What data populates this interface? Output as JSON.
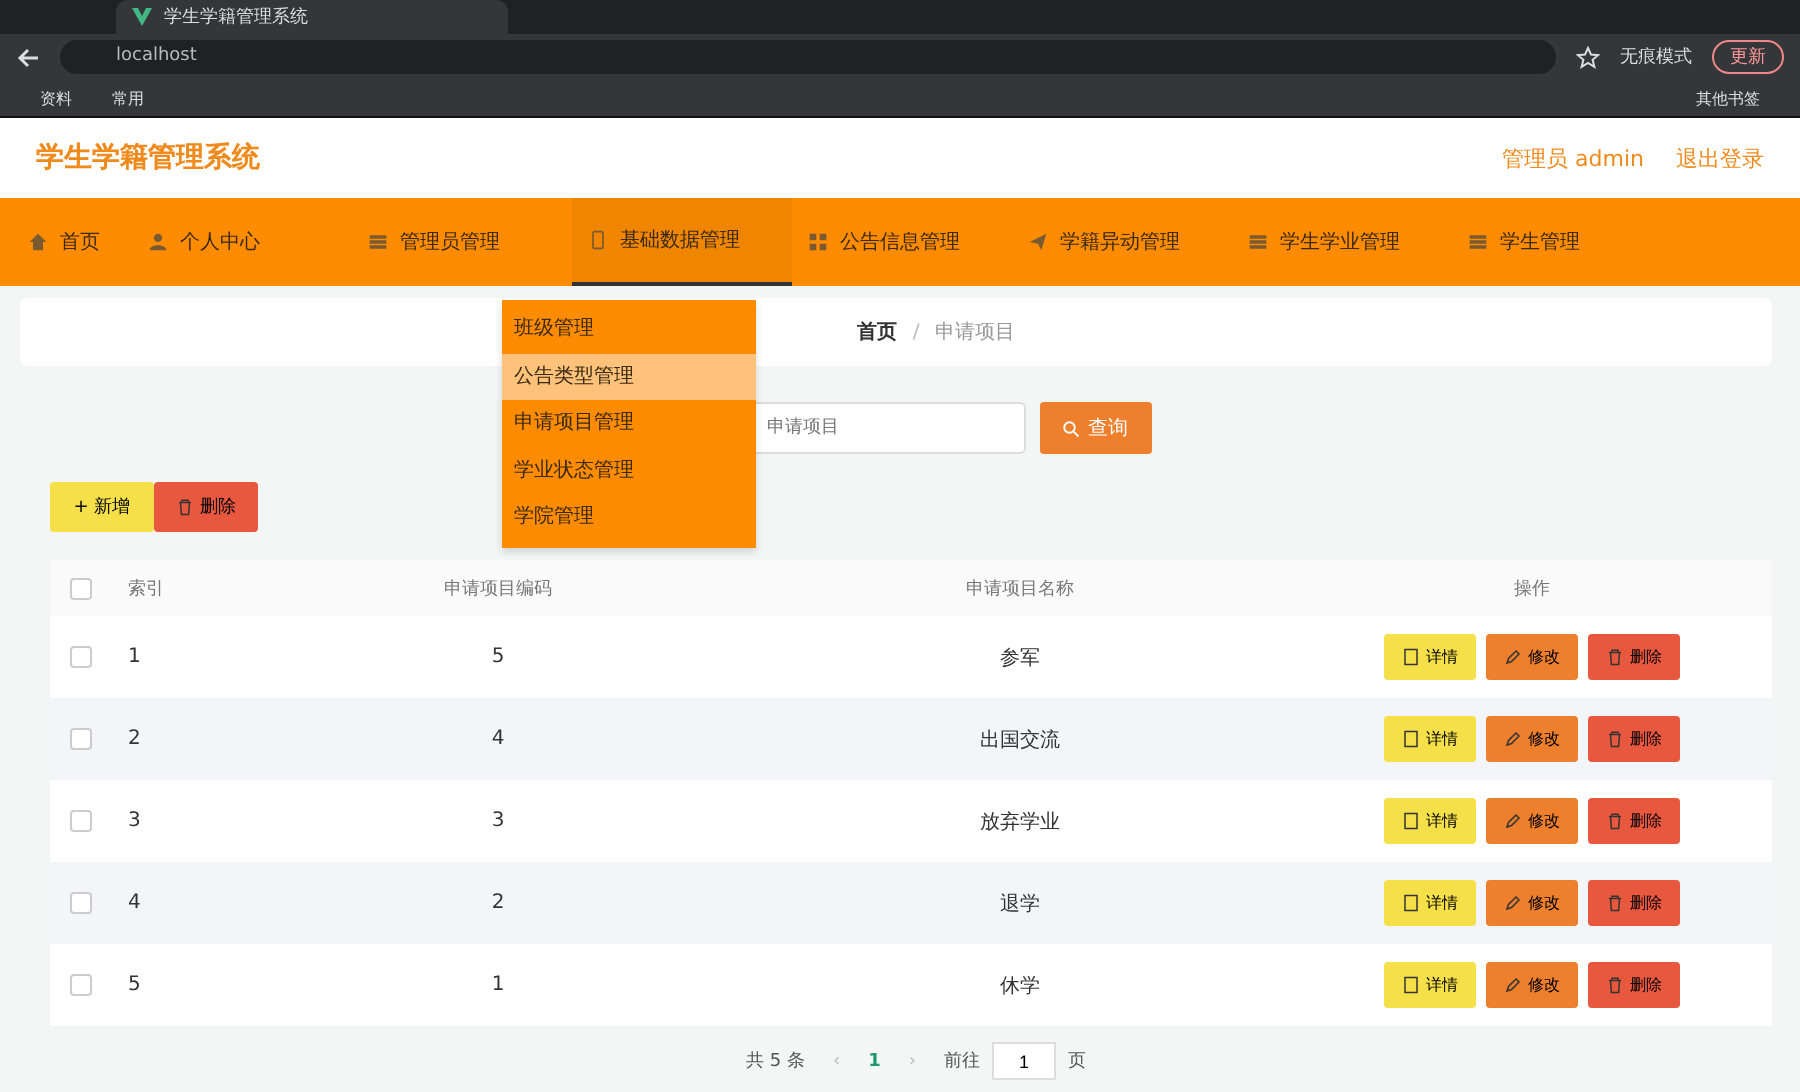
{
  "browser": {
    "tab_title": "学生学籍管理系统",
    "address": "localhost",
    "profile": "无痕模式",
    "update_button": "更新",
    "bookmarks": [
      "资料",
      "常用"
    ],
    "other_bookmarks": "其他书签"
  },
  "header": {
    "title": "学生学籍管理系统",
    "user": "管理员 admin",
    "logout": "退出登录"
  },
  "nav": [
    {
      "label": "首页",
      "selected": false
    },
    {
      "label": "个人中心",
      "selected": false
    },
    {
      "label": "管理员管理",
      "selected": false
    },
    {
      "label": "基础数据管理",
      "selected": true
    },
    {
      "label": "公告信息管理",
      "selected": false
    },
    {
      "label": "学籍异动管理",
      "selected": false
    },
    {
      "label": "学生学业管理",
      "selected": false
    },
    {
      "label": "学生管理",
      "selected": false
    }
  ],
  "dropdown": [
    {
      "label": "班级管理",
      "selected": false
    },
    {
      "label": "公告类型管理",
      "selected": true
    },
    {
      "label": "申请项目管理",
      "selected": false
    },
    {
      "label": "学业状态管理",
      "selected": false
    },
    {
      "label": "学院管理",
      "selected": false
    }
  ],
  "breadcrumb": {
    "items": [
      "首页",
      "申请项目"
    ],
    "separator": "/"
  },
  "search": {
    "placeholder": "申请项目",
    "button": "查询"
  },
  "actions": {
    "add": "+ 新增",
    "delete": "删除"
  },
  "table": {
    "select_all_checked": false,
    "columns": [
      "索引",
      "申请项目编码",
      "申请项目名称",
      "操作"
    ],
    "rows": [
      {
        "index": "1",
        "code": "5",
        "name": "参军",
        "checked": false,
        "buttons": [
          "详情",
          "修改",
          "删除"
        ]
      },
      {
        "index": "2",
        "code": "4",
        "name": "出国交流",
        "checked": false,
        "buttons": [
          "详情",
          "修改",
          "删除"
        ]
      },
      {
        "index": "3",
        "code": "3",
        "name": "放弃学业",
        "checked": false,
        "buttons": [
          "详情",
          "修改",
          "删除"
        ]
      },
      {
        "index": "4",
        "code": "2",
        "name": "退学",
        "checked": false,
        "buttons": [
          "详情",
          "修改",
          "删除"
        ]
      },
      {
        "index": "5",
        "code": "1",
        "name": "休学",
        "checked": false,
        "buttons": [
          "详情",
          "修改",
          "删除"
        ]
      }
    ]
  },
  "pagination": {
    "total": "共 5 条",
    "prev": "‹",
    "page": "1",
    "next": "›",
    "goto": "前往",
    "goto_value": "1",
    "page_suffix": "页"
  }
}
